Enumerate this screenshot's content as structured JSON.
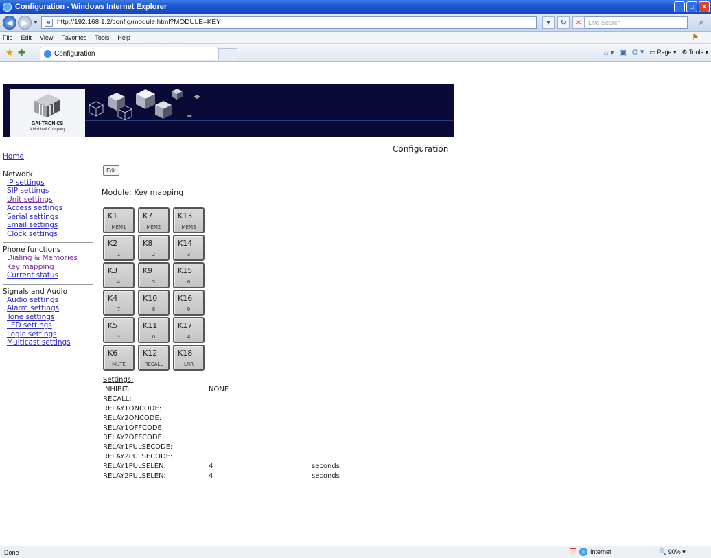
{
  "window": {
    "title": "Configuration - Windows Internet Explorer"
  },
  "addressbar": {
    "url": "http://192.168.1.2/config/module.html?MODULE=KEY",
    "search_placeholder": "Live Search"
  },
  "menu": [
    "File",
    "Edit",
    "View",
    "Favorites",
    "Tools",
    "Help"
  ],
  "tab": {
    "label": "Configuration"
  },
  "commandbar": {
    "page_label": "Page",
    "tools_label": "Tools"
  },
  "banner": {
    "company": "GAI-TRONICS",
    "tagline": "A Hubbell Company"
  },
  "page": {
    "heading": "Configuration",
    "edit_label": "Edit",
    "module_label": "Module: Key mapping"
  },
  "sidebar": {
    "home": "Home",
    "network": {
      "title": "Network",
      "links": [
        "IP settings",
        "SIP settings",
        "Unit settings",
        "Access settings",
        "Serial settings",
        "Email settings",
        "Clock settings"
      ]
    },
    "phone": {
      "title": "Phone functions",
      "links": [
        "Dialing & Memories",
        "Key mapping",
        "Current status"
      ]
    },
    "signals": {
      "title": "Signals and Audio",
      "links": [
        "Audio settings",
        "Alarm settings",
        "Tone settings",
        "LED settings",
        "Logic settings",
        "Multicast settings"
      ]
    }
  },
  "keys": [
    {
      "name": "K1",
      "func": "MEM1"
    },
    {
      "name": "K7",
      "func": "MEM2"
    },
    {
      "name": "K13",
      "func": "MEM3"
    },
    {
      "name": "K2",
      "func": "1"
    },
    {
      "name": "K8",
      "func": "2"
    },
    {
      "name": "K14",
      "func": "3"
    },
    {
      "name": "K3",
      "func": "4"
    },
    {
      "name": "K9",
      "func": "5"
    },
    {
      "name": "K15",
      "func": "6"
    },
    {
      "name": "K4",
      "func": "7"
    },
    {
      "name": "K10",
      "func": "8"
    },
    {
      "name": "K16",
      "func": "9"
    },
    {
      "name": "K5",
      "func": "*"
    },
    {
      "name": "K11",
      "func": "0"
    },
    {
      "name": "K17",
      "func": "#"
    },
    {
      "name": "K6",
      "func": "MUTE"
    },
    {
      "name": "K12",
      "func": "RECALL"
    },
    {
      "name": "K18",
      "func": "LNR"
    }
  ],
  "settings": {
    "title": "Settings:",
    "rows": [
      {
        "label": "INHIBIT:",
        "value": "NONE",
        "unit": ""
      },
      {
        "label": "RECALL:",
        "value": "",
        "unit": ""
      },
      {
        "label": "RELAY1ONCODE:",
        "value": "",
        "unit": ""
      },
      {
        "label": "RELAY2ONCODE:",
        "value": "",
        "unit": ""
      },
      {
        "label": "RELAY1OFFCODE:",
        "value": "",
        "unit": ""
      },
      {
        "label": "RELAY2OFFCODE:",
        "value": "",
        "unit": ""
      },
      {
        "label": "RELAY1PULSECODE:",
        "value": "",
        "unit": ""
      },
      {
        "label": "RELAY2PULSECODE:",
        "value": "",
        "unit": ""
      },
      {
        "label": "RELAY1PULSELEN:",
        "value": "4",
        "unit": "seconds"
      },
      {
        "label": "RELAY2PULSELEN:",
        "value": "4",
        "unit": "seconds"
      }
    ]
  },
  "status": {
    "left": "Done",
    "zone": "Internet",
    "zoom": "90%"
  }
}
